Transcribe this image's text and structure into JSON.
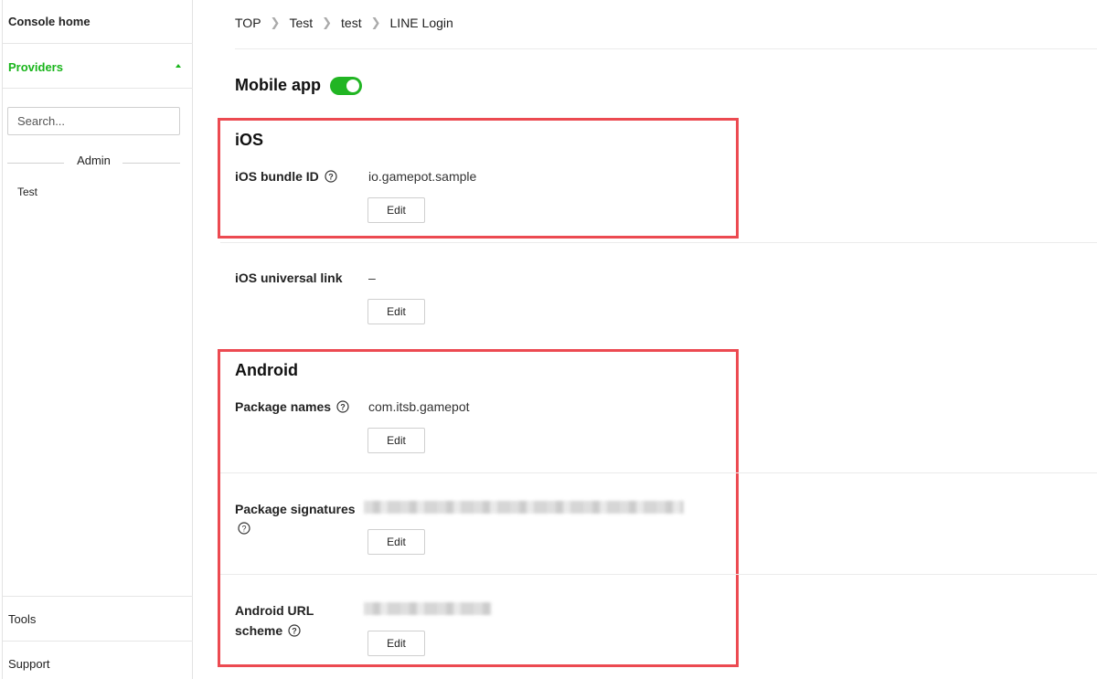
{
  "sidebar": {
    "console_home": "Console home",
    "providers": "Providers",
    "search_placeholder": "Search...",
    "group_label": "Admin",
    "items": [
      {
        "label": "Test"
      }
    ],
    "tools": "Tools",
    "support": "Support"
  },
  "breadcrumb": [
    "TOP",
    "Test",
    "test",
    "LINE Login"
  ],
  "mobile_app": {
    "title": "Mobile app",
    "enabled": true
  },
  "ios": {
    "title": "iOS",
    "bundle_id_label": "iOS bundle ID",
    "bundle_id_value": "io.gamepot.sample",
    "universal_link_label": "iOS universal link",
    "universal_link_value": "–"
  },
  "android": {
    "title": "Android",
    "package_names_label": "Package names",
    "package_names_value": "com.itsb.gamepot",
    "package_signatures_label": "Package signatures",
    "url_scheme_label_line1": "Android URL",
    "url_scheme_label_line2": "scheme"
  },
  "buttons": {
    "edit": "Edit"
  },
  "colors": {
    "accent_green": "#19b51b",
    "highlight_red": "#ec4a51"
  }
}
